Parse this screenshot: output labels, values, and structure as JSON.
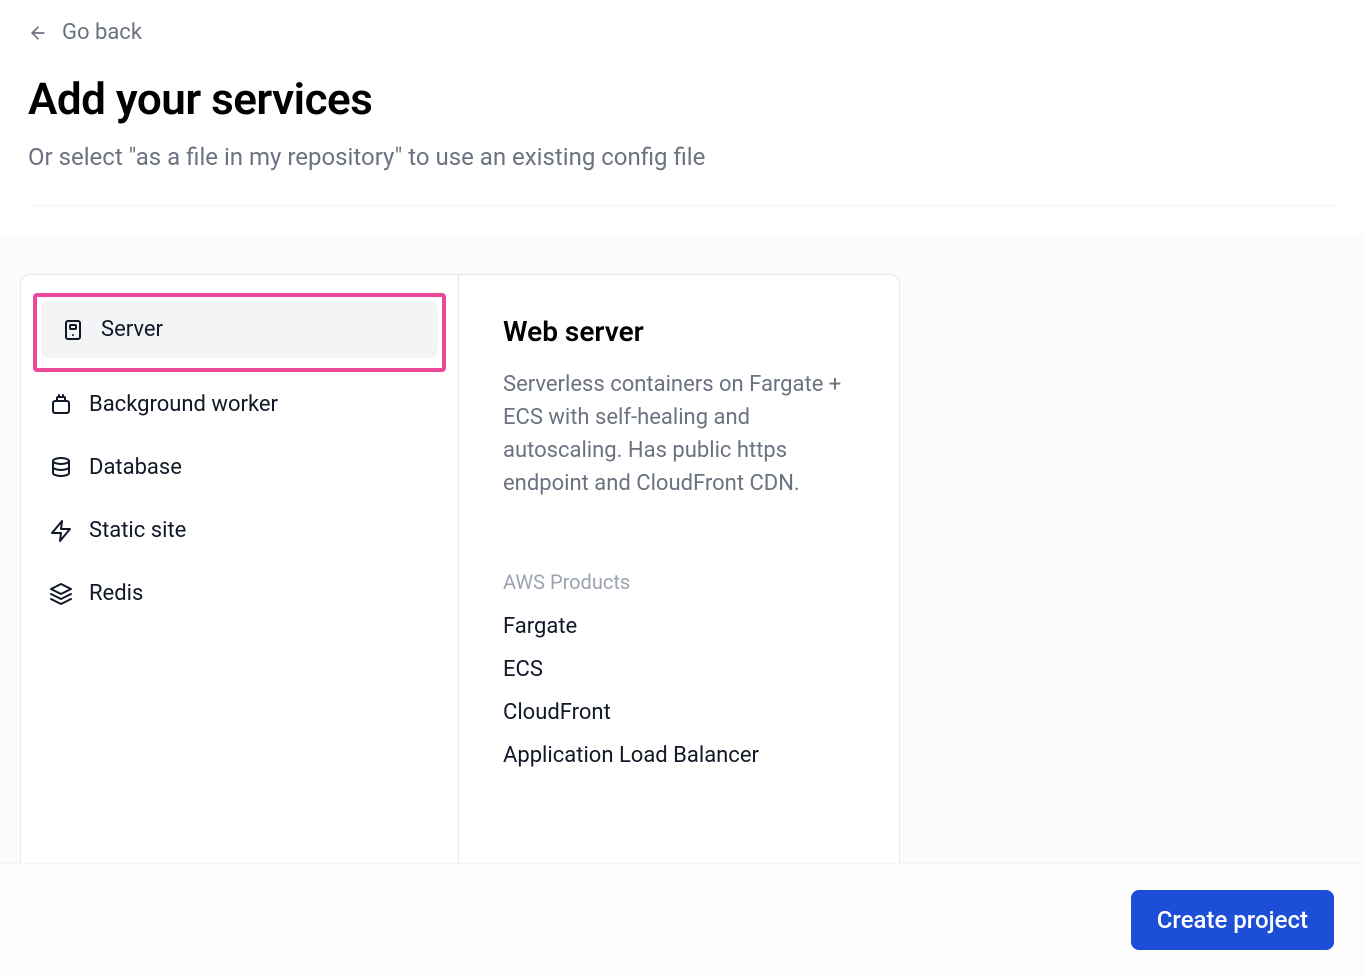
{
  "header": {
    "go_back": "Go back",
    "title": "Add your services",
    "subtitle": "Or select \"as a file in my repository\" to use an existing config file"
  },
  "sidebar": {
    "items": [
      {
        "label": "Server",
        "icon": "server-icon",
        "selected": true,
        "highlighted": true
      },
      {
        "label": "Background worker",
        "icon": "background-worker-icon",
        "selected": false,
        "highlighted": false
      },
      {
        "label": "Database",
        "icon": "database-icon",
        "selected": false,
        "highlighted": false
      },
      {
        "label": "Static site",
        "icon": "lightning-icon",
        "selected": false,
        "highlighted": false
      },
      {
        "label": "Redis",
        "icon": "layers-icon",
        "selected": false,
        "highlighted": false
      }
    ]
  },
  "detail": {
    "title": "Web server",
    "description": "Serverless containers on Fargate + ECS with self-healing and autoscaling. Has public https endpoint and CloudFront CDN.",
    "products_label": "AWS Products",
    "products": [
      "Fargate",
      "ECS",
      "CloudFront",
      "Application Load Balancer"
    ]
  },
  "footer": {
    "create": "Create project"
  },
  "colors": {
    "highlight": "#ec4899",
    "primary_button": "#1d4ed8"
  }
}
